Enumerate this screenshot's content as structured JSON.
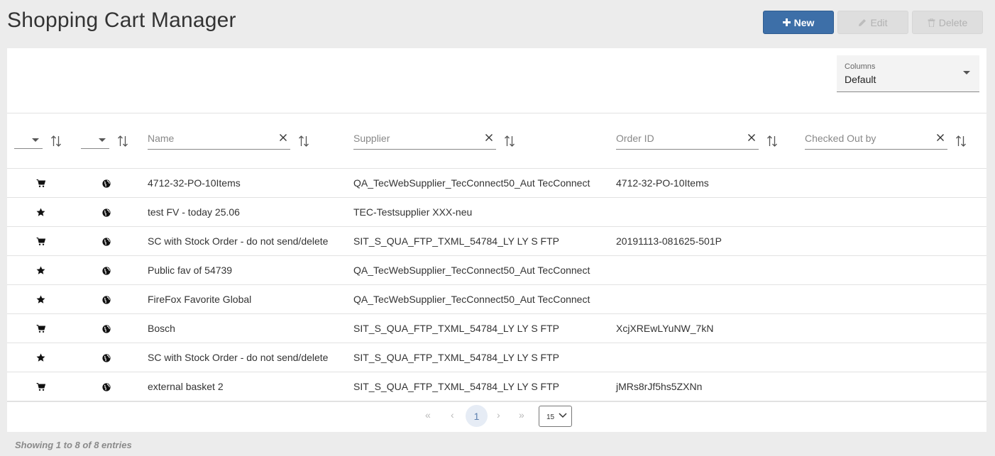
{
  "header": {
    "title": "Shopping Cart Manager",
    "new_label": "New",
    "edit_label": "Edit",
    "delete_label": "Delete"
  },
  "columns_select": {
    "label": "Columns",
    "value": "Default"
  },
  "filters": {
    "name_placeholder": "Name",
    "supplier_placeholder": "Supplier",
    "order_placeholder": "Order ID",
    "checked_placeholder": "Checked Out by"
  },
  "rows": [
    {
      "type_icon": "cart-icon",
      "scope_icon": "globe-icon",
      "name": "4712-32-PO-10Items",
      "supplier": "QA_TecWebSupplier_TecConnect50_Aut TecConnect",
      "order_id": "4712-32-PO-10Items",
      "checked_out_by": ""
    },
    {
      "type_icon": "star-icon",
      "scope_icon": "globe-icon",
      "name": "test FV - today 25.06",
      "supplier": "TEC-Testsupplier XXX-neu",
      "order_id": "",
      "checked_out_by": ""
    },
    {
      "type_icon": "cart-icon",
      "scope_icon": "globe-icon",
      "name": "SC with Stock Order - do not send/delete",
      "supplier": "SIT_S_QUA_FTP_TXML_54784_LY LY S FTP",
      "order_id": "20191113-081625-501P",
      "checked_out_by": ""
    },
    {
      "type_icon": "star-icon",
      "scope_icon": "globe-icon",
      "name": "Public fav of 54739",
      "supplier": "QA_TecWebSupplier_TecConnect50_Aut TecConnect",
      "order_id": "",
      "checked_out_by": ""
    },
    {
      "type_icon": "star-icon",
      "scope_icon": "globe-icon",
      "name": "FireFox Favorite Global",
      "supplier": "QA_TecWebSupplier_TecConnect50_Aut TecConnect",
      "order_id": "",
      "checked_out_by": ""
    },
    {
      "type_icon": "cart-icon",
      "scope_icon": "globe-icon",
      "name": "Bosch",
      "supplier": "SIT_S_QUA_FTP_TXML_54784_LY LY S FTP",
      "order_id": "XcjXREwLYuNW_7kN",
      "checked_out_by": ""
    },
    {
      "type_icon": "star-icon",
      "scope_icon": "globe-icon",
      "name": "SC with Stock Order - do not send/delete",
      "supplier": "SIT_S_QUA_FTP_TXML_54784_LY LY S FTP",
      "order_id": "",
      "checked_out_by": ""
    },
    {
      "type_icon": "cart-icon",
      "scope_icon": "globe-icon",
      "name": "external basket 2",
      "supplier": "SIT_S_QUA_FTP_TXML_54784_LY LY S FTP",
      "order_id": "jMRs8rJf5hs5ZXNn",
      "checked_out_by": ""
    }
  ],
  "pagination": {
    "first": "«",
    "prev": "‹",
    "current_page": "1",
    "next": "›",
    "last": "»",
    "page_size": "15"
  },
  "footer": {
    "info": "Showing 1 to 8 of 8 entries"
  },
  "colors": {
    "primary": "#3d6fa8",
    "disabled": "#dedede",
    "background": "#ececec"
  }
}
